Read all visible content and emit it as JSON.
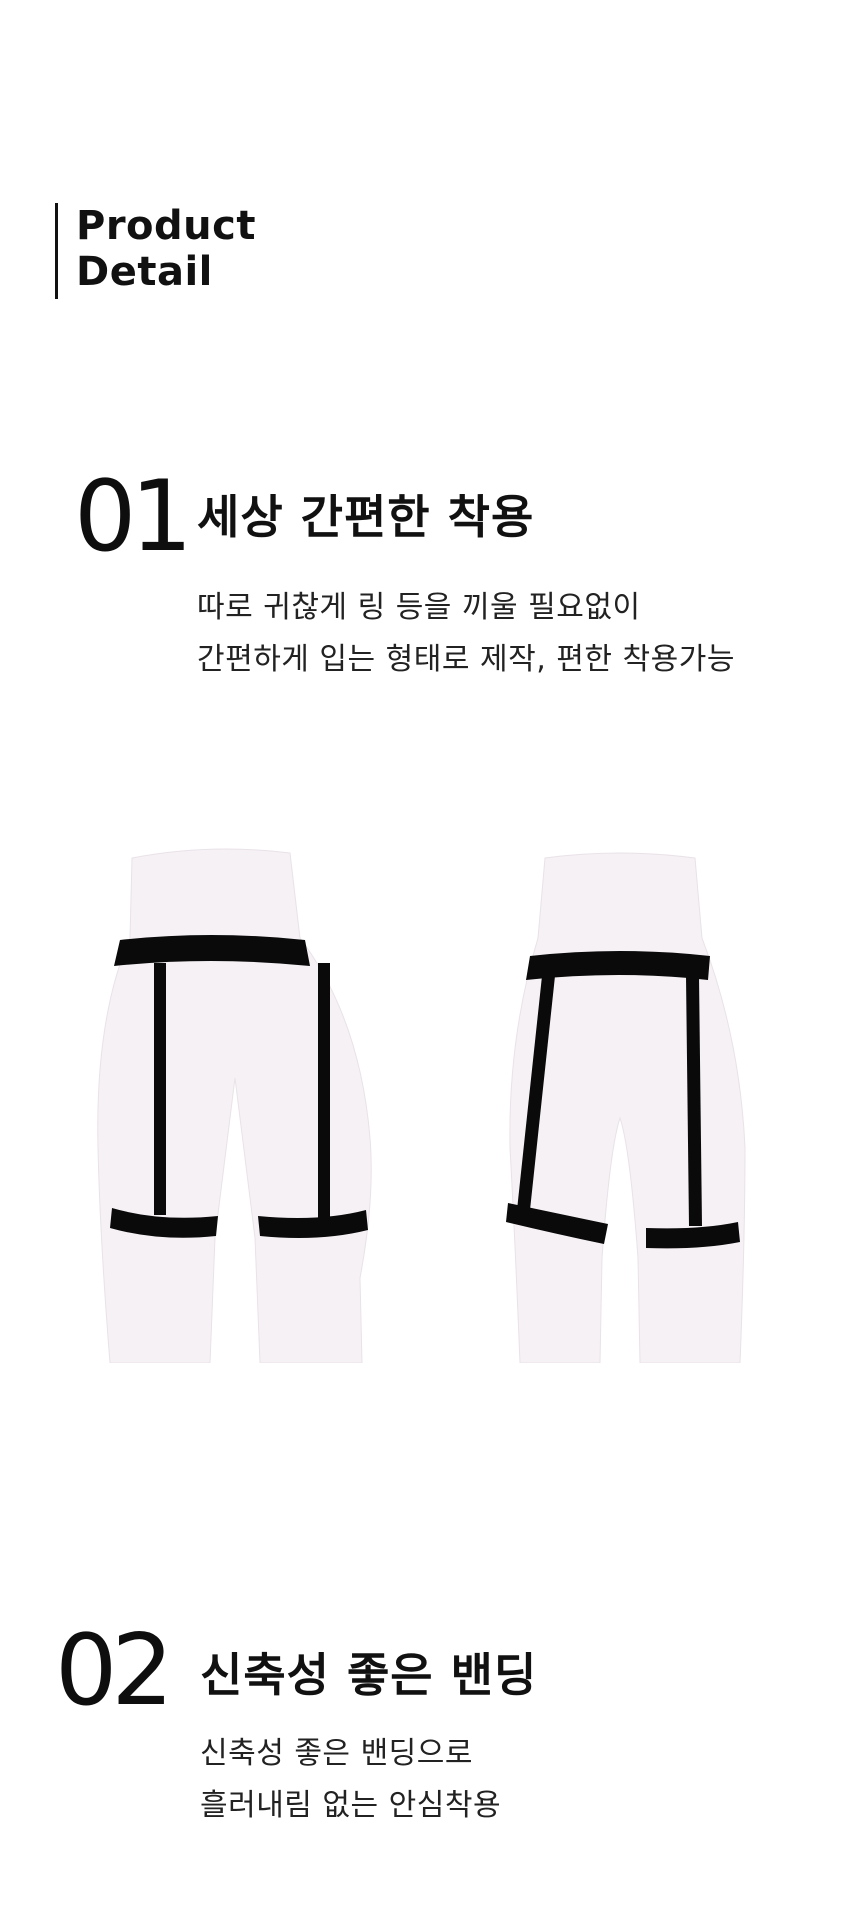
{
  "header": {
    "line1": "Product",
    "line2": "Detail"
  },
  "sections": [
    {
      "number": "01",
      "title": "세상 간편한 착용",
      "lines": [
        "따로 귀찮게 링 등을 끼울 필요없이",
        "간편하게 입는 형태로 제작, 편한 착용가능"
      ]
    },
    {
      "number": "02",
      "title": "신축성 좋은 밴딩",
      "lines": [
        "신축성 좋은 밴딩으로",
        "흘러내림 없는 안심착용"
      ]
    }
  ],
  "image": {
    "description_icon": "mannequin-garter-front-back",
    "colors": {
      "mannequin": "#f6f1f5",
      "band": "#0a0a0a"
    }
  }
}
